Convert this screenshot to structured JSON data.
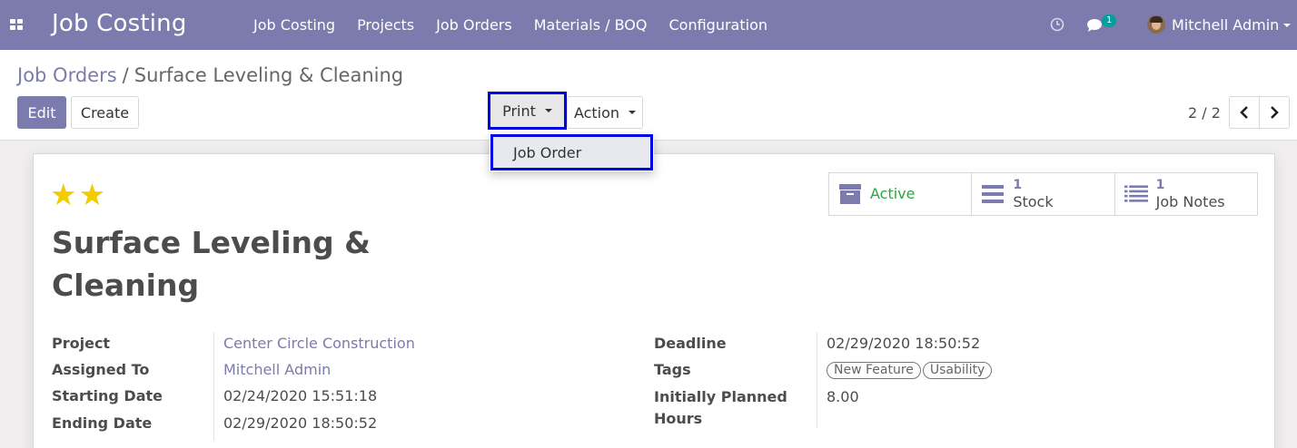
{
  "navbar": {
    "app_title": "Job Costing",
    "menu": [
      "Job Costing",
      "Projects",
      "Job Orders",
      "Materials / BOQ",
      "Configuration"
    ],
    "chat_badge": "1",
    "user_name": "Mitchell Admin",
    "bg_color": "#7c7bad"
  },
  "breadcrumb": {
    "parent": "Job Orders",
    "separator": "/",
    "current": "Surface Leveling & Cleaning"
  },
  "toolbar": {
    "edit_label": "Edit",
    "create_label": "Create",
    "print_label": "Print",
    "action_label": "Action"
  },
  "print_menu": {
    "items": [
      "Job Order"
    ]
  },
  "pager": {
    "value": "2 / 2"
  },
  "record": {
    "priority_stars": 2,
    "title": "Surface Leveling & Cleaning"
  },
  "smart_buttons": {
    "active_label": "Active",
    "stock_count": "1",
    "stock_label": "Stock",
    "notes_count": "1",
    "notes_label": "Job Notes"
  },
  "fields_left": [
    {
      "label": "Project",
      "value": "Center Circle Construction",
      "link": true
    },
    {
      "label": "Assigned To",
      "value": "Mitchell Admin",
      "link": true
    },
    {
      "label": "Starting Date",
      "value": "02/24/2020 15:51:18",
      "link": false
    },
    {
      "label": "Ending Date",
      "value": "02/29/2020 18:50:52",
      "link": false
    }
  ],
  "fields_right": {
    "deadline_label": "Deadline",
    "deadline_value": "02/29/2020 18:50:52",
    "tags_label": "Tags",
    "tags": [
      "New Feature",
      "Usability"
    ],
    "planned_label_1": "Initially Planned",
    "planned_label_2": "Hours",
    "planned_value": "8.00"
  }
}
